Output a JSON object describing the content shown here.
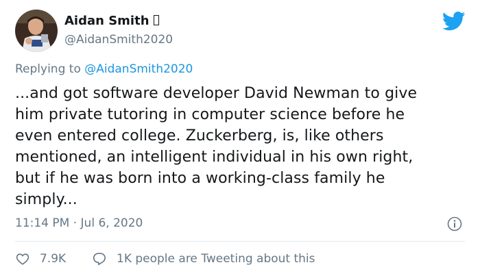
{
  "tweet": {
    "author_name": "Aidan Smith",
    "author_handle": "@AidanSmith2020",
    "replying_prefix": "Replying to",
    "replying_to": "@AidanSmith2020",
    "body_lines": [
      "...and got software developer David Newman to give",
      "him private tutoring in computer science before he",
      "even entered college. Zuckerberg, is, like others",
      "mentioned, an intelligent individual in his own right,",
      "but if he was born into a working-class family he",
      "simply..."
    ],
    "timestamp": "11:14 PM · Jul 6, 2020",
    "likes": "7.9K",
    "conversation": "1K people are Tweeting about this"
  },
  "icons": {
    "brand": "twitter-bird-icon",
    "info": "info-icon",
    "like": "heart-icon",
    "reply": "reply-bubble-icon"
  },
  "colors": {
    "brand_blue": "#1da1f2",
    "link_blue": "#1b95e0",
    "secondary_text": "#657786",
    "primary_text": "#14171a",
    "divider": "#e1e8ed"
  }
}
